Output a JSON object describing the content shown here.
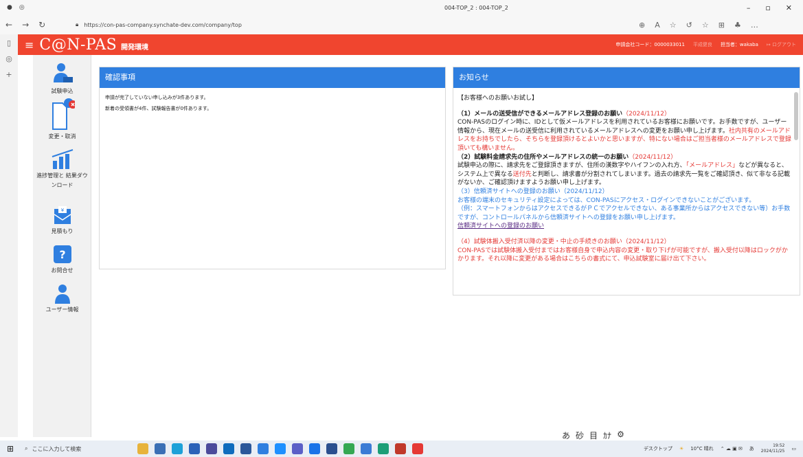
{
  "browser": {
    "tab_title": "004-TOP_2 : 004-TOP_2",
    "url": "https://con-pas-company.synchate-dev.com/company/top"
  },
  "header": {
    "logo": "C@N-PAS",
    "env": "開発環境",
    "company_code": "申請会社コード：0000033011",
    "user_faint": "平成健良",
    "person": "担当者：wakaba",
    "logout": "ログアウト"
  },
  "sidebar": {
    "items": [
      {
        "label": "試験申込",
        "icon": "person-laptop-icon"
      },
      {
        "label": "変更・取消",
        "icon": "document-cancel-icon"
      },
      {
        "label": "進捗管理と 結果ダウンロード",
        "icon": "bar-chart-icon"
      },
      {
        "label": "見積もり",
        "icon": "yen-envelope-icon"
      },
      {
        "label": "お問合せ",
        "icon": "question-icon"
      },
      {
        "label": "ユーザー情報",
        "icon": "user-icon"
      }
    ]
  },
  "confirm": {
    "title": "確認事項",
    "line1": "申請が完了していない申し込みが3件あります。",
    "line2": "新着の受領書が4件、試験報告書が0件あります。"
  },
  "notice": {
    "title": "お知らせ",
    "intro": "【お客様へのお願いお試し】",
    "n1_title": "（1）メールの送受信ができるメールアドレス登録のお願い",
    "n1_date": "（2024/11/12）",
    "n1_body": "CON-PASのログイン時に、IDとして仮メールアドレスを利用されているお客様にお願いです。お手数ですが、ユーザー情報から、現在メールの送受信に利用されているメールアドレスへの変更をお願い申し上げます。",
    "n1_red": "社内共有のメールアドレスをお持ちでしたら、そちらを登録頂けるとよいかと思いますが、特にない場合はご担当者様のメールアドレスで登録頂いても構いません。",
    "n2_title": "（2）試験料金請求先の住所やメールアドレスの統一のお願い",
    "n2_date": "（2024/11/12）",
    "n2_body_a": "試験申込の際に、請求先をご登録頂きますが、住所の漢数字やハイフンの入れ方、",
    "n2_red_a": "「メールアドレス」",
    "n2_body_b": "などが異なると、システム上で異なる",
    "n2_red_b": "送付先",
    "n2_body_c": "と判断し、請求書が分割されてしまいます。過去の請求先一覧をご確認頂き、似て非なる記載がないか、ご確認頂けますようお願い申し上げます。",
    "n3_title": "（3）信頼済サイトへの登録のお願い（2024/11/12）",
    "n3_body": "お客様の端末のセキュリティ設定によっては、CON-PASにアクセス・ログインできないことがございます。",
    "n3_example": "（例：スマートフォンからはアクセスできるがＰＣでアクセルできない、ある事業所からはアクセスできない等）お手数ですが、コントロールパネルから信頼済サイトへの登録をお願い申し上げます。",
    "n3_link": "信頼済サイトへの登録のお願い",
    "n4_title": "（4）試験体搬入受付済以降の変更・中止の手続きのお願い（2024/11/12）",
    "n4_body": "CON-PASでは試験体搬入受付まではお客様自身で申込内容の変更・取り下げが可能ですが、搬入受付以降はロックがかかります。それ以降に変更がある場合はこちらの書式にて、申込試験室に届け出て下さい。"
  },
  "ime": {
    "a": "あ",
    "b": "砂",
    "c": "目",
    "d": "ｶﾅ",
    "e": "⚙"
  },
  "taskbar": {
    "search": "ここに入力して検索",
    "desktop": "デスクトップ",
    "weather": "10°C 晴れ",
    "time": "19:52",
    "date": "2024/11/25"
  },
  "colors": {
    "brand": "#f0452f",
    "panel_head": "#2f7fe0",
    "red_text": "#e53935"
  }
}
